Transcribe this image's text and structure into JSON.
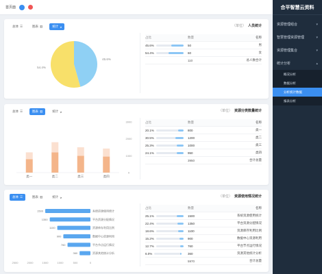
{
  "topbar": {
    "crumb": "首页面"
  },
  "sidebar": {
    "brand": "合平智慧云资料",
    "items": [
      {
        "label": "资源管理组合"
      },
      {
        "label": "智慧管理资源管理"
      },
      {
        "label": "资源管理集合"
      },
      {
        "label": "统计分析"
      }
    ],
    "subitems": [
      {
        "label": "概况分析"
      },
      {
        "label": "数据分析"
      },
      {
        "label": "分析统计数据",
        "active": true
      },
      {
        "label": "报表分析"
      }
    ]
  },
  "panel1": {
    "tabs": [
      {
        "label": "总体"
      },
      {
        "label": "图表"
      },
      {
        "label": "统计"
      }
    ],
    "title": "人员统计",
    "hint": "（单位）",
    "table": {
      "headers": [
        "占比",
        "数量",
        "名称"
      ],
      "rows": [
        {
          "pct": "45.6%",
          "pct_value": 45.6,
          "num": "50",
          "name": "男"
        },
        {
          "pct": "54.4%",
          "pct_value": 54.4,
          "num": "60",
          "name": "女"
        }
      ],
      "footer": {
        "num": "110",
        "name": "总人数合计"
      }
    }
  },
  "panel2": {
    "tabs": [
      {
        "label": "总体"
      },
      {
        "label": "图表"
      },
      {
        "label": "统计"
      }
    ],
    "title": "资源分类数量统计",
    "hint": "（单位）",
    "table": {
      "headers": [
        "占比",
        "数量",
        "名称"
      ],
      "rows": [
        {
          "pct": "20.1%",
          "pct_value": 20.1,
          "num": "800",
          "name": "类一"
        },
        {
          "pct": "30.5%",
          "pct_value": 30.5,
          "num": "1200",
          "name": "类二"
        },
        {
          "pct": "25.3%",
          "pct_value": 25.3,
          "num": "1000",
          "name": "类三"
        },
        {
          "pct": "24.1%",
          "pct_value": 24.1,
          "num": "950",
          "name": "类四"
        }
      ],
      "footer": {
        "num": "3950",
        "name": "合计总量"
      }
    }
  },
  "panel3": {
    "tabs": [
      {
        "label": "总体"
      },
      {
        "label": "图表"
      },
      {
        "label": "统计"
      }
    ],
    "title": "资源使用情况统计",
    "hint": "（单位）",
    "table": {
      "headers": [
        "占比",
        "数量",
        "名称"
      ],
      "rows": [
        {
          "pct": "25.1%",
          "pct_value": 25.1,
          "num": "1500",
          "name": "系统资源使用统计"
        },
        {
          "pct": "22.4%",
          "pct_value": 22.4,
          "num": "1350",
          "name": "平台资源分配情况"
        },
        {
          "pct": "18.6%",
          "pct_value": 18.6,
          "num": "1100",
          "name": "资源库存利用比例"
        },
        {
          "pct": "15.2%",
          "pct_value": 15.2,
          "num": "900",
          "name": "数据中心资源利用"
        },
        {
          "pct": "12.7%",
          "pct_value": 12.7,
          "num": "760",
          "name": "平台节点运行情况"
        },
        {
          "pct": "6.0%",
          "pct_value": 6.0,
          "num": "360",
          "name": "资源其他统计分析"
        }
      ],
      "footer": {
        "num": "5970",
        "name": "合计总量"
      }
    }
  },
  "chart_data": [
    {
      "type": "pie",
      "categories": [
        "男",
        "女"
      ],
      "values": [
        45.6,
        54.4
      ],
      "labels": [
        "45.6%",
        "54.4%"
      ],
      "colors": [
        "#8fd0f4",
        "#f8e06a"
      ]
    },
    {
      "type": "bar",
      "categories": [
        "类一",
        "类二",
        "类三",
        "类四"
      ],
      "series": [
        {
          "values": [
            800,
            1200,
            1000,
            950
          ],
          "color": "#f4b58a"
        },
        {
          "values": [
            400,
            600,
            500,
            475
          ],
          "color": "#fbe0d0"
        }
      ],
      "ylim": [
        0,
        3000
      ],
      "yticks": [
        "0",
        "1000",
        "2000",
        "3000"
      ]
    },
    {
      "type": "bar",
      "orientation": "horizontal",
      "categories": [
        "系统资源使用统计",
        "平台资源分配情况",
        "资源库存利用比例",
        "数据中心资源利用",
        "平台节点运行情况",
        "资源其他统计分析"
      ],
      "values": [
        1500,
        1350,
        1100,
        900,
        760,
        360
      ],
      "value_labels": [
        "1500",
        "1350",
        "1100",
        "900",
        "760",
        "360"
      ],
      "color": "#5aa7ef",
      "xticks": [
        "0",
        "500",
        "1000",
        "1500",
        "2000",
        "2500"
      ]
    }
  ]
}
